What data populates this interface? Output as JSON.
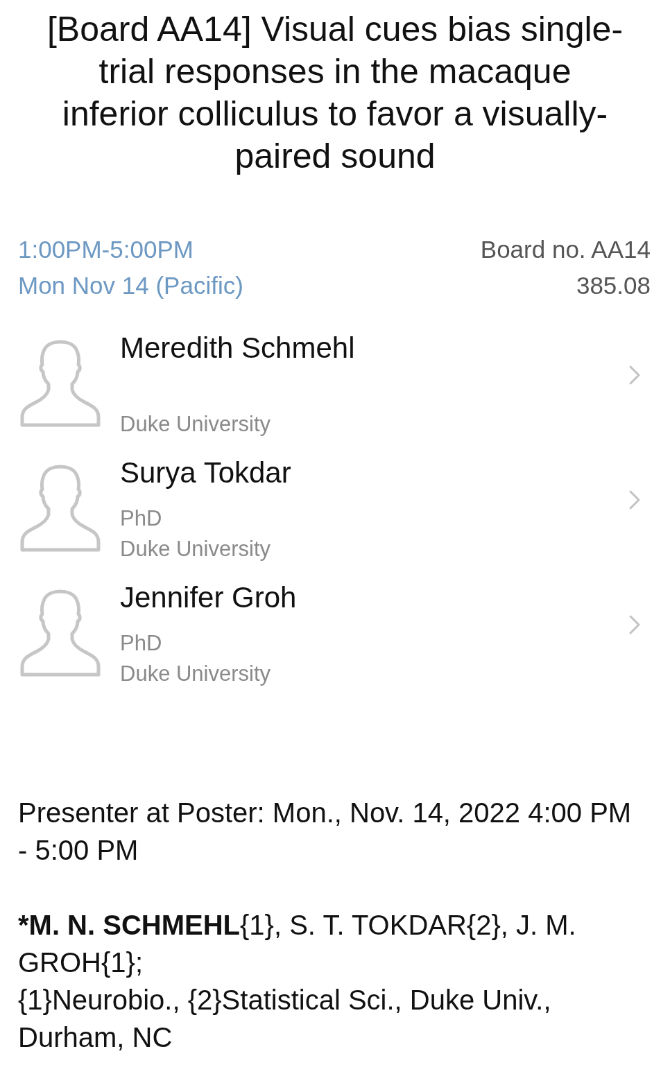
{
  "title": "[Board AA14] Visual cues bias single-trial responses in the macaque inferior colliculus to favor a visually-paired sound",
  "session": {
    "time": "1:00PM-5:00PM",
    "date": "Mon Nov 14 (Pacific)",
    "board": "Board no. AA14",
    "number": "385.08"
  },
  "people": [
    {
      "name": "Meredith Schmehl",
      "affiliation": "Duke University"
    },
    {
      "name": "Surya Tokdar",
      "degree": "PhD",
      "affiliation": "Duke University"
    },
    {
      "name": "Jennifer Groh",
      "degree": "PhD",
      "affiliation": "Duke University"
    }
  ],
  "presenter_time": "Presenter at Poster: Mon., Nov. 14, 2022 4:00 PM - 5:00 PM",
  "authors": {
    "lead": "*M. N. SCHMEHL",
    "rest": "{1}, S. T. TOKDAR{2}, J. M. GROH{1};"
  },
  "affiliations": "{1}Neurobio., {2}Statistical Sci., Duke Univ., Durham, NC"
}
